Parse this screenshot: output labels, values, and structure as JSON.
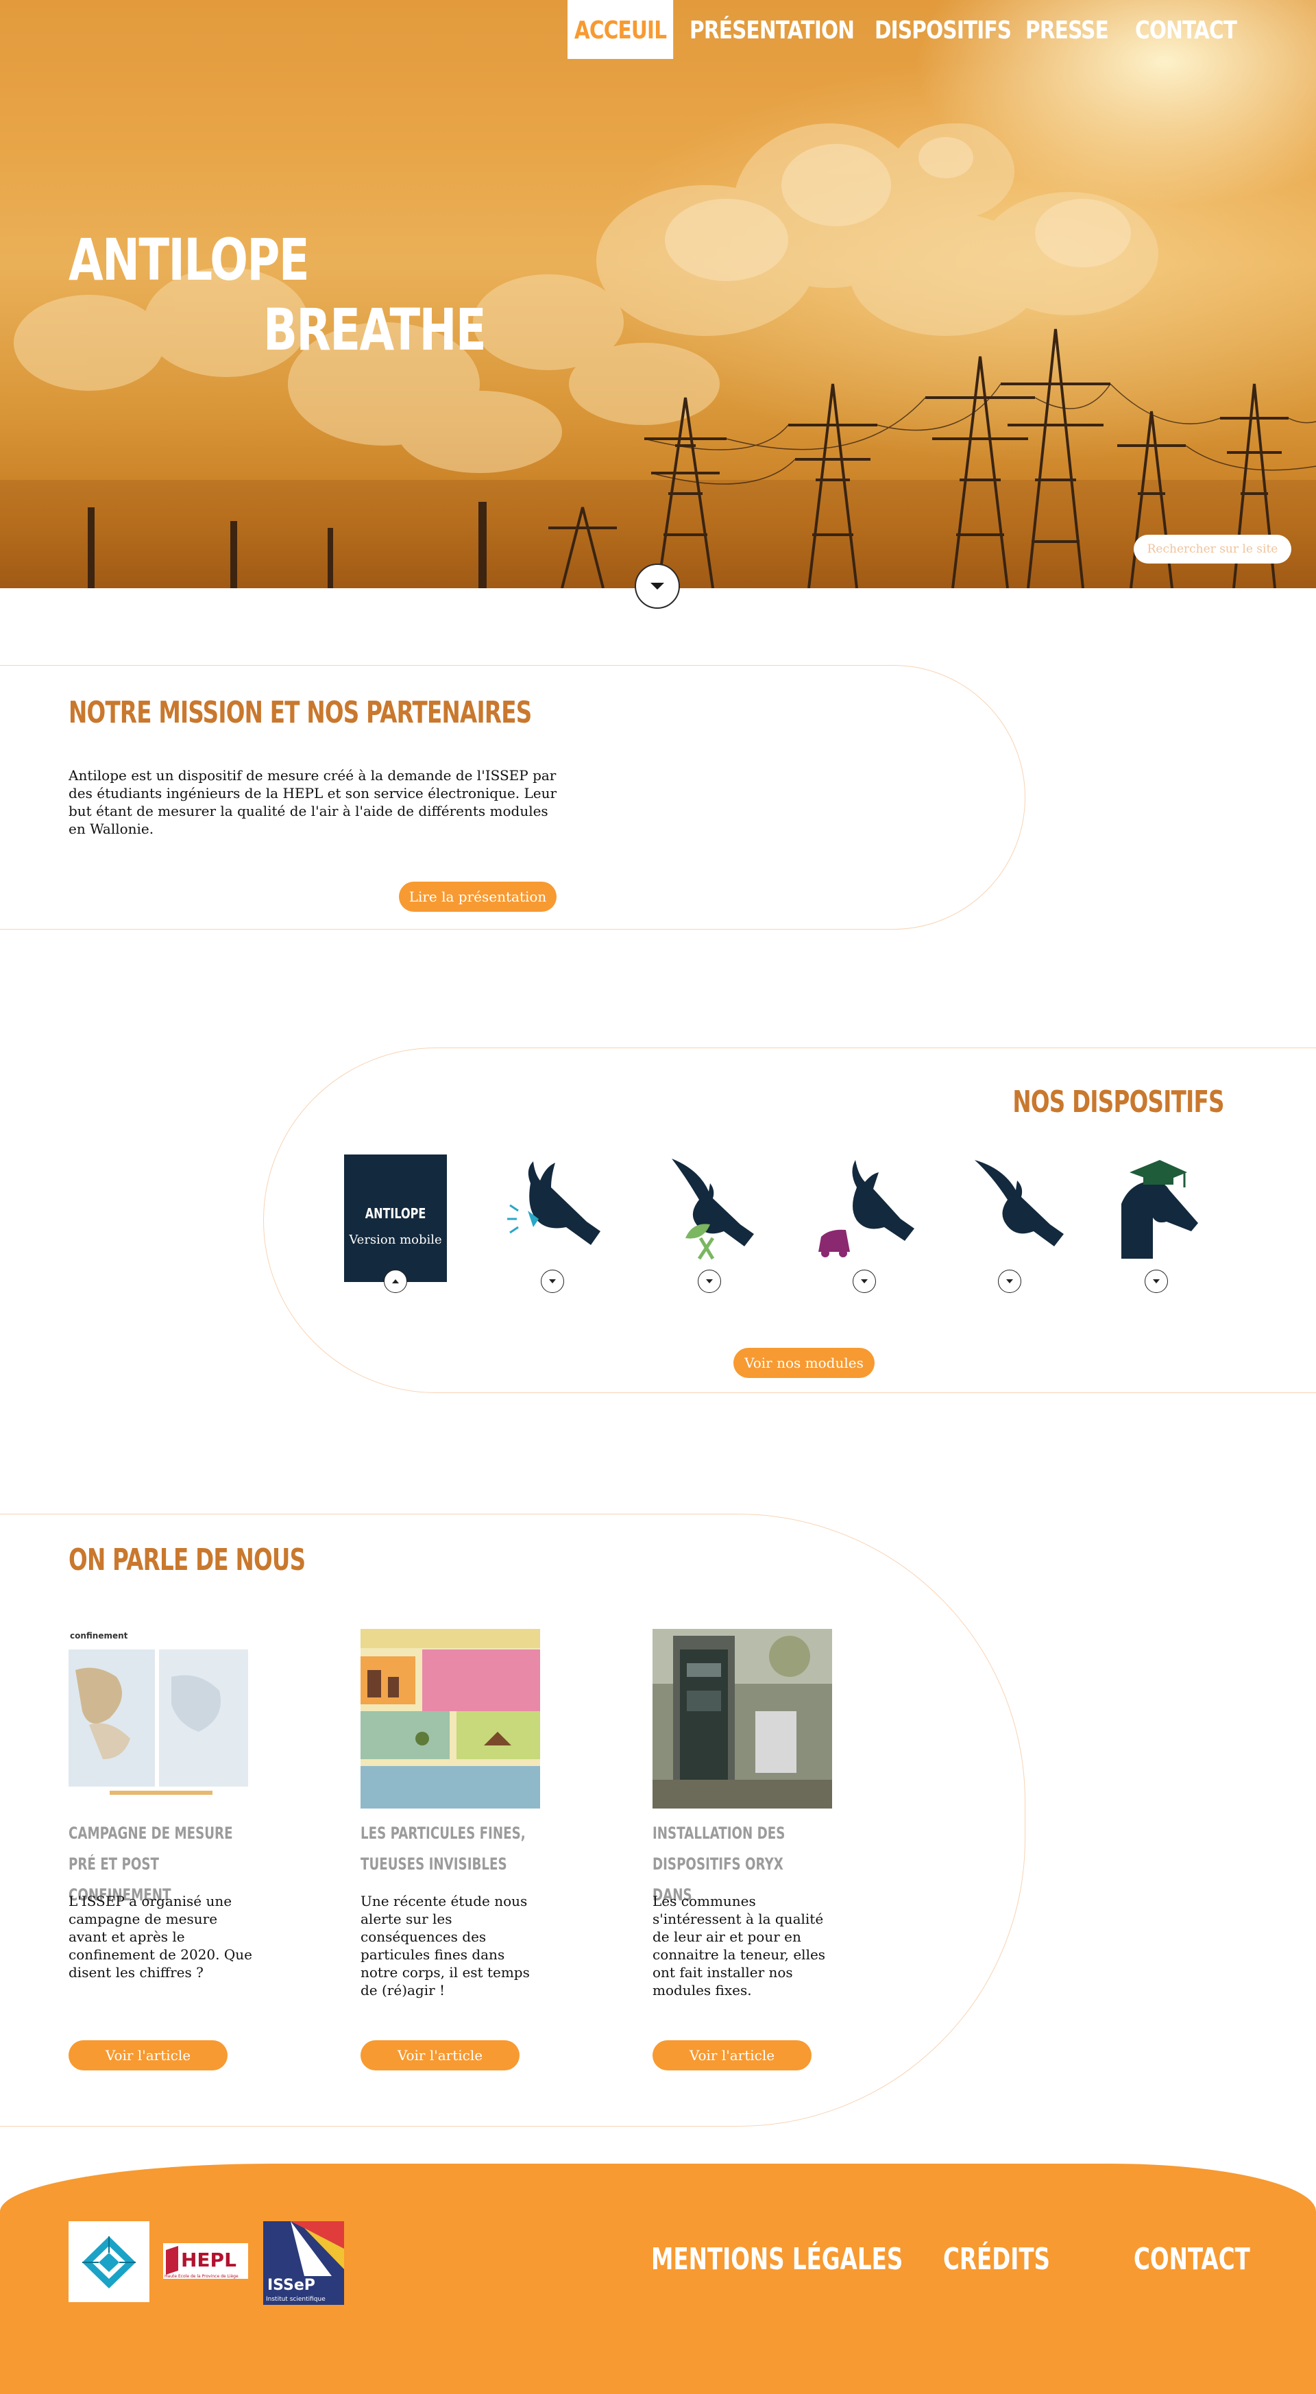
{
  "nav": {
    "items": [
      {
        "label": "ACCEUIL",
        "active": true
      },
      {
        "label": "PRÉSENTATION",
        "active": false
      },
      {
        "label": "DISPOSITIFS",
        "active": false
      },
      {
        "label": "PRESSE",
        "active": false
      },
      {
        "label": "CONTACT",
        "active": false
      }
    ]
  },
  "hero": {
    "title_line1": "ANTILOPE",
    "title_line2": "BREATHE",
    "search_placeholder": "Rechercher sur le site",
    "scroll_icon": "chevron-down-icon"
  },
  "mission": {
    "title": "NOTRE MISSION ET NOS PARTENAIRES",
    "text": "Antilope est un dispositif de mesure créé à la demande de l'ISSEP par des étudiants ingénieurs de la HEPL et son service électronique. Leur but étant de mesurer la qualité de l'air à l'aide de différents modules en Wallonie.",
    "button": "Lire la présentation"
  },
  "devices": {
    "title": "NOS DISPOSITIFS",
    "card": {
      "title": "ANTILOPE",
      "subtitle": "Version mobile"
    },
    "icons": [
      "antelope-card",
      "antelope-megaphone-icon",
      "oryx-leaf-icon",
      "antelope-car-icon",
      "oryx-icon",
      "antelope-graduate-icon"
    ],
    "button": "Voir nos modules"
  },
  "press": {
    "title": "ON PARLE DE NOUS",
    "articles": [
      {
        "image_caption": "confinement",
        "title": "CAMPAGNE DE MESURE PRÉ ET POST CONFINEMENT",
        "text": "L'ISSEP a organisé une campagne de mesure avant et après le confinement de 2020. Que disent les chiffres ?",
        "button": "Voir l'article"
      },
      {
        "image_caption": "",
        "title": "LES PARTICULES FINES, TUEUSES INVISIBLES",
        "text": "Une récente étude nous alerte sur les conséquences des particules fines dans notre corps, il est temps de (ré)agir !",
        "button": "Voir l'article"
      },
      {
        "image_caption": "",
        "title": "INSTALLATION DES DISPOSITIFS ORYX DANS",
        "text": "Les communes s'intéressent à la qualité de leur air et pour en connaitre la teneur, elles ont fait installer nos modules fixes.",
        "button": "Voir l'article"
      }
    ]
  },
  "footer": {
    "links": [
      "MENTIONS LÉGALES",
      "CRÉDITS",
      "CONTACT"
    ],
    "logos": {
      "hepl": "HEPL",
      "hepl_sub": "Haute Ecole de la Province de Liège",
      "issep": "ISSeP",
      "issep_sub": "Institut scientifique"
    }
  },
  "colors": {
    "accent": "#f79a31",
    "title": "#c9782d",
    "dark": "#13293d",
    "muted": "#9b9b9b"
  }
}
